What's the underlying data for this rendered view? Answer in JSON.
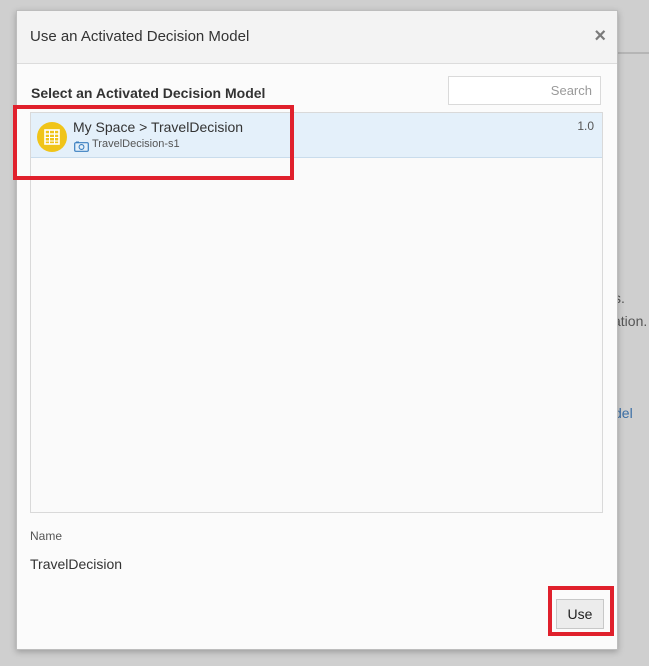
{
  "background_fragments": [
    "s.",
    "ation.",
    "del"
  ],
  "dialog": {
    "title": "Use an Activated Decision Model",
    "close_symbol": "×",
    "section_title": "Select an Activated Decision Model",
    "search": {
      "placeholder": "Search",
      "value": ""
    },
    "items": [
      {
        "title": "My Space > TravelDecision",
        "snapshot": "TravelDecision-s1",
        "version": "1.0",
        "icon": "decision-table-icon",
        "selected": true
      }
    ],
    "name_label": "Name",
    "name_value": "TravelDecision",
    "use_button": "Use"
  },
  "colors": {
    "accent_icon": "#f0c419",
    "selected_row": "#e4f0fa",
    "highlight_annotation": "#e0202c"
  }
}
